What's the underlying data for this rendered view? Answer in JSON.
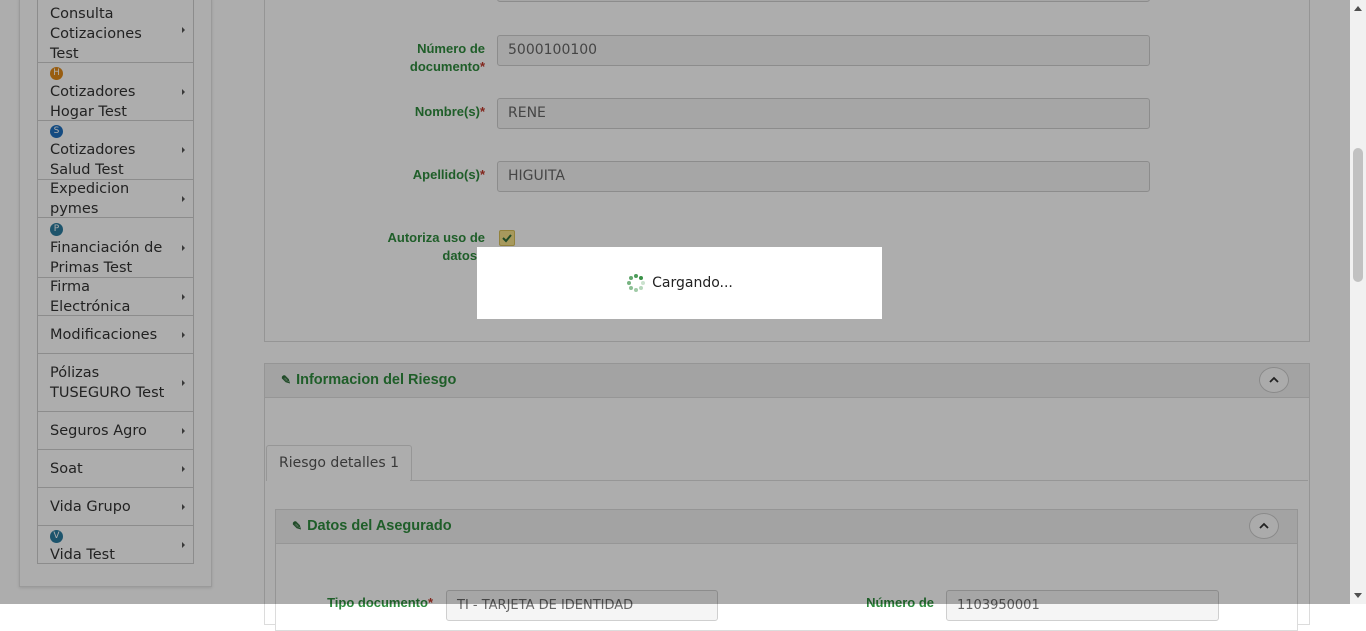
{
  "sidebar": {
    "items": [
      {
        "label": "Consulta Cotizaciones Test",
        "icon": "",
        "icon_letter": ""
      },
      {
        "label": "Cotizadores Hogar Test",
        "icon": "hogar-icon",
        "icon_letter": "H"
      },
      {
        "label": "Cotizadores Salud Test",
        "icon": "salud-icon",
        "icon_letter": "S"
      },
      {
        "label": "Expedicion pymes",
        "icon": "",
        "icon_letter": ""
      },
      {
        "label": "Financiación de Primas Test",
        "icon": "financiacion-icon",
        "icon_letter": "P"
      },
      {
        "label": "Firma Electrónica",
        "icon": "",
        "icon_letter": ""
      },
      {
        "label": "Modificaciones",
        "icon": "",
        "icon_letter": ""
      },
      {
        "label": "Pólizas TUSEGURO Test",
        "icon": "",
        "icon_letter": ""
      },
      {
        "label": "Seguros Agro",
        "icon": "",
        "icon_letter": ""
      },
      {
        "label": "Soat",
        "icon": "",
        "icon_letter": ""
      },
      {
        "label": "Vida Grupo",
        "icon": "",
        "icon_letter": ""
      },
      {
        "label": "Vida Test",
        "icon": "vida-icon",
        "icon_letter": "V"
      }
    ]
  },
  "form": {
    "numero_documento": {
      "label": "Número de documento",
      "value": "5000100100"
    },
    "nombres": {
      "label": "Nombre(s)",
      "value": "RENE"
    },
    "apellidos": {
      "label": "Apellido(s)",
      "value": "HIGUITA"
    },
    "autoriza": {
      "label": "Autoriza uso de datos?",
      "checked": true
    }
  },
  "riesgo": {
    "title": "Informacion del Riesgo",
    "tab_label": "Riesgo detalles 1"
  },
  "asegurado": {
    "title": "Datos del Asegurado",
    "tipo_documento_label": "Tipo documento",
    "tipo_documento_value": "TI - TARJETA DE IDENTIDAD",
    "numero_label": "Número de",
    "numero_value": "1103950001"
  },
  "loading": {
    "text": "Cargando..."
  },
  "colors": {
    "accent": "#2e8b3d",
    "required": "#c0392b",
    "checkbox": "#f7e28a"
  }
}
